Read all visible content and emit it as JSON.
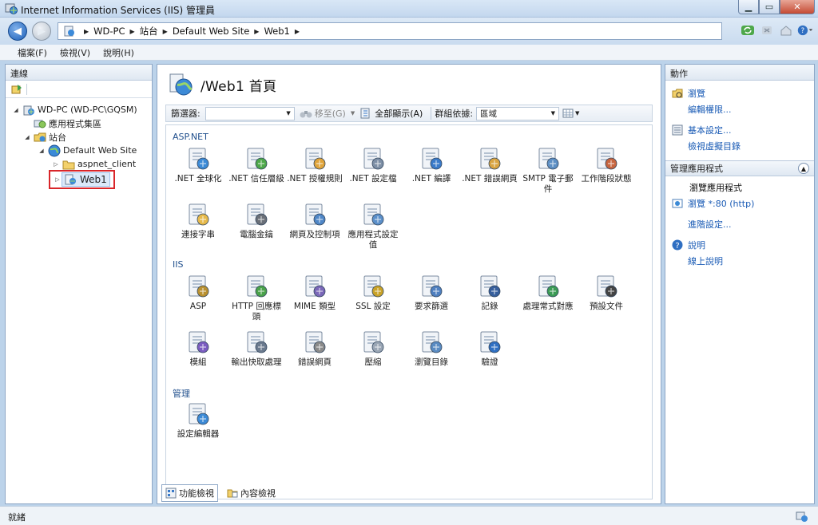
{
  "window": {
    "title": "Internet Information Services (IIS) 管理員"
  },
  "breadcrumb": [
    "WD-PC",
    "站台",
    "Default Web Site",
    "Web1"
  ],
  "menu": [
    "檔案(F)",
    "檢視(V)",
    "說明(H)"
  ],
  "connections": {
    "header": "連線",
    "tree": [
      {
        "label": "WD-PC (WD-PC\\GQSM)",
        "level": 0,
        "expander": "◢",
        "icon": "server-icon"
      },
      {
        "label": "應用程式集區",
        "level": 1,
        "expander": "",
        "icon": "app-pool-icon"
      },
      {
        "label": "站台",
        "level": 1,
        "expander": "◢",
        "icon": "sites-folder-icon"
      },
      {
        "label": "Default Web Site",
        "level": 2,
        "expander": "◢",
        "icon": "globe-icon"
      },
      {
        "label": "aspnet_client",
        "level": 3,
        "expander": "▷",
        "icon": "folder-icon"
      },
      {
        "label": "Web1",
        "level": 3,
        "expander": "▷",
        "icon": "web-app-icon",
        "selected": true
      }
    ]
  },
  "center": {
    "title": "/Web1 首頁",
    "filter": {
      "label": "篩選器:",
      "go": "移至(G)",
      "show_all": "全部顯示(A)",
      "group_label": "群組依據:",
      "group_value": "區域"
    },
    "sections": [
      {
        "name": "ASP.NET",
        "items": [
          {
            "label": ".NET 全球化",
            "icon": "globalization-icon"
          },
          {
            "label": ".NET 信任層級",
            "icon": "trust-level-icon"
          },
          {
            "label": ".NET 授權規則",
            "icon": "authorization-icon"
          },
          {
            "label": ".NET 設定檔",
            "icon": "profile-icon"
          },
          {
            "label": ".NET 編譯",
            "icon": "compilation-icon"
          },
          {
            "label": ".NET 錯誤網頁",
            "icon": "error-page-icon"
          },
          {
            "label": "SMTP 電子郵件",
            "icon": "smtp-icon"
          },
          {
            "label": "工作階段狀態",
            "icon": "session-state-icon"
          },
          {
            "label": "連接字串",
            "icon": "connection-string-icon"
          },
          {
            "label": "電腦金鑰",
            "icon": "machine-key-icon"
          },
          {
            "label": "網頁及控制項",
            "icon": "pages-controls-icon"
          },
          {
            "label": "應用程式設定值",
            "icon": "app-settings-icon"
          }
        ]
      },
      {
        "name": "IIS",
        "items": [
          {
            "label": "ASP",
            "icon": "asp-icon"
          },
          {
            "label": "HTTP 回應標頭",
            "icon": "http-headers-icon"
          },
          {
            "label": "MIME 類型",
            "icon": "mime-icon"
          },
          {
            "label": "SSL 設定",
            "icon": "ssl-lock-icon"
          },
          {
            "label": "要求篩選",
            "icon": "request-filter-icon"
          },
          {
            "label": "記錄",
            "icon": "logging-icon"
          },
          {
            "label": "處理常式對應",
            "icon": "handler-mapping-icon"
          },
          {
            "label": "預設文件",
            "icon": "default-document-icon"
          },
          {
            "label": "模組",
            "icon": "modules-icon"
          },
          {
            "label": "輸出快取處理",
            "icon": "output-cache-icon"
          },
          {
            "label": "錯誤網頁",
            "icon": "error-pages-icon"
          },
          {
            "label": "壓縮",
            "icon": "compression-icon"
          },
          {
            "label": "瀏覽目錄",
            "icon": "directory-browsing-icon"
          },
          {
            "label": "驗證",
            "icon": "authentication-icon"
          }
        ]
      },
      {
        "name": "管理",
        "items": [
          {
            "label": "設定編輯器",
            "icon": "config-editor-icon"
          }
        ]
      }
    ]
  },
  "bottom_tabs": [
    {
      "label": "功能檢視",
      "active": true,
      "icon": "features-view-icon"
    },
    {
      "label": "內容檢視",
      "active": false,
      "icon": "content-view-icon"
    }
  ],
  "actions": {
    "header": "動作",
    "group1": [
      {
        "label": "瀏覽",
        "link": true,
        "icon": "explore-icon"
      },
      {
        "label": "編輯權限...",
        "link": true,
        "icon": ""
      }
    ],
    "group2": [
      {
        "label": "基本設定...",
        "link": true,
        "icon": "basic-settings-icon"
      },
      {
        "label": "檢視虛擬目錄",
        "link": true,
        "icon": ""
      }
    ],
    "manage_header": "管理應用程式",
    "browse_header": "瀏覽應用程式",
    "group3": [
      {
        "label": "瀏覽 *:80 (http)",
        "link": true,
        "icon": "browse-icon"
      }
    ],
    "group4": [
      {
        "label": "進階設定...",
        "link": true,
        "icon": ""
      }
    ],
    "group5": [
      {
        "label": "說明",
        "link": true,
        "icon": "help-icon"
      },
      {
        "label": "線上說明",
        "link": true,
        "icon": ""
      }
    ]
  },
  "status": {
    "text": "就緒"
  },
  "colors": {
    "accent": "#1a5bb5",
    "selection_border": "#d9262a"
  }
}
